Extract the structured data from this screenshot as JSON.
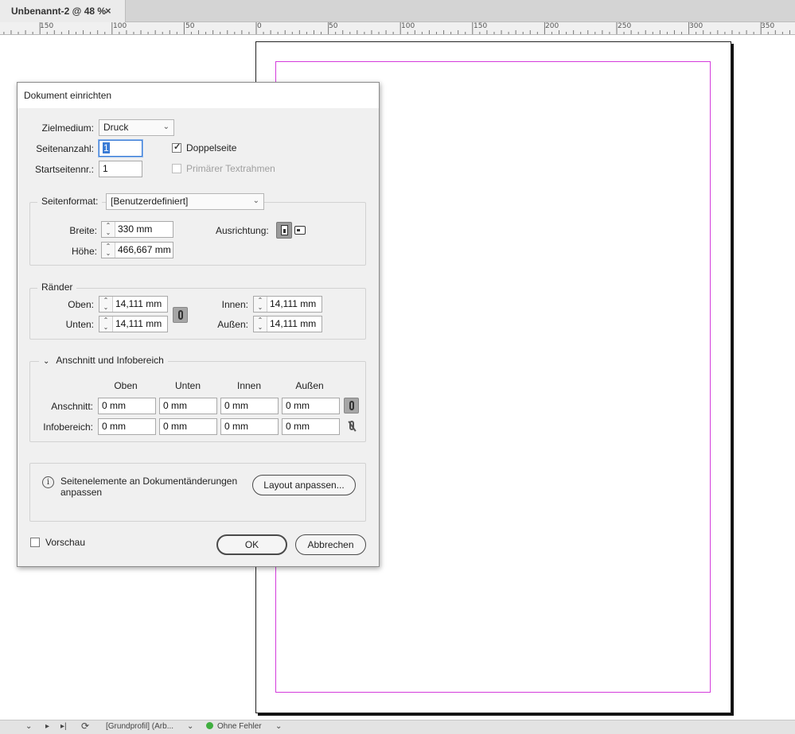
{
  "tab": {
    "title": "Unbenannt-2 @ 48 %",
    "close_glyph": "×"
  },
  "ruler": {
    "labels": [
      "150",
      "100",
      "50",
      "0",
      "50",
      "100",
      "150",
      "200",
      "250",
      "300",
      "350"
    ]
  },
  "dialog": {
    "title": "Dokument einrichten",
    "zielmedium": {
      "label": "Zielmedium:",
      "value": "Druck"
    },
    "seitenanzahl": {
      "label": "Seitenanzahl:",
      "value": "1"
    },
    "doppelseite": {
      "label": "Doppelseite",
      "checked": true
    },
    "startseite": {
      "label": "Startseitennr.:",
      "value": "1"
    },
    "primaer": {
      "label": "Primärer Textrahmen",
      "checked": false,
      "disabled": true
    },
    "seitenformat": {
      "label": "Seitenformat:",
      "value": "[Benutzerdefiniert]",
      "breite_label": "Breite:",
      "breite": "330 mm",
      "hoehe_label": "Höhe:",
      "hoehe": "466,667 mm",
      "ausrichtung_label": "Ausrichtung:"
    },
    "raender": {
      "title": "Ränder",
      "oben_label": "Oben:",
      "oben": "14,111 mm",
      "unten_label": "Unten:",
      "unten": "14,111 mm",
      "innen_label": "Innen:",
      "innen": "14,111 mm",
      "aussen_label": "Außen:",
      "aussen": "14,111 mm"
    },
    "anschnitt": {
      "title": "Anschnitt und Infobereich",
      "columns": [
        "Oben",
        "Unten",
        "Innen",
        "Außen"
      ],
      "anschnitt_label": "Anschnitt:",
      "anschnitt_values": [
        "0 mm",
        "0 mm",
        "0 mm",
        "0 mm"
      ],
      "info_label": "Infobereich:",
      "info_values": [
        "0 mm",
        "0 mm",
        "0 mm",
        "0 mm"
      ]
    },
    "adjust": {
      "text_line1": "Seitenelemente an Dokumentänderungen",
      "text_line2": "anpassen",
      "button": "Layout anpassen..."
    },
    "vorschau": {
      "label": "Vorschau",
      "checked": false
    },
    "ok": "OK",
    "cancel": "Abbrechen"
  },
  "statusbar": {
    "profile": "[Grundprofil] (Arb...",
    "status": "Ohne Fehler",
    "status_color": "#3fae3f"
  },
  "colors": {
    "margin_guide": "#d43cdc",
    "focus": "#3a7bd5"
  }
}
